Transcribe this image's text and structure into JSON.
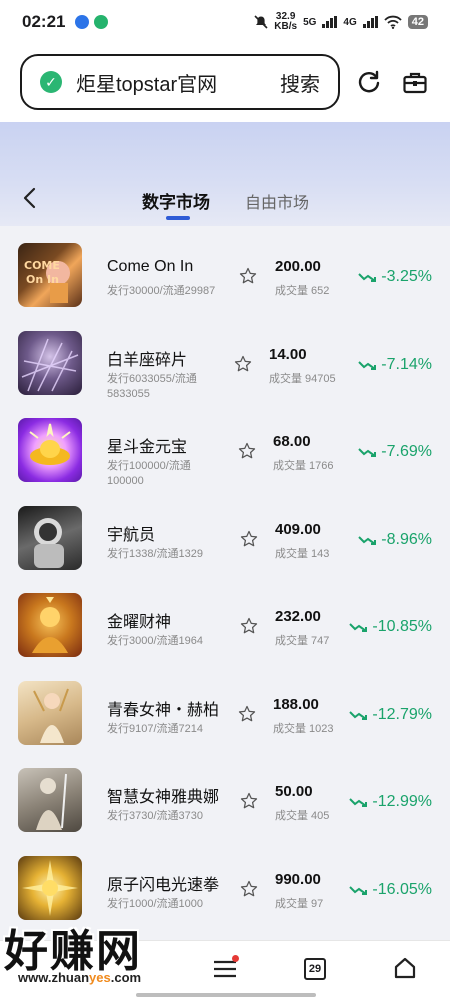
{
  "status_bar": {
    "time": "02:21",
    "net_speed": "32.9",
    "net_unit": "KB/s",
    "sig1": "5G",
    "sig2": "4G",
    "battery": "42"
  },
  "browser": {
    "url_text": "炬星topstar官网",
    "search_label": "搜索"
  },
  "header": {
    "tab_active": "数字市场",
    "tab_other": "自由市场"
  },
  "colors": {
    "accent": "#2e5bd6",
    "down": "#1aa36b"
  },
  "items": [
    {
      "name": "Come On In",
      "sub": "发行30000/流通29987",
      "price": "200.00",
      "volume": "成交量 652",
      "change": "-3.25%"
    },
    {
      "name": "白羊座碎片",
      "sub": "发行6033055/流通5833055",
      "price": "14.00",
      "volume": "成交量 94705",
      "change": "-7.14%"
    },
    {
      "name": "星斗金元宝",
      "sub": "发行100000/流通100000",
      "price": "68.00",
      "volume": "成交量 1766",
      "change": "-7.69%"
    },
    {
      "name": "宇航员",
      "sub": "发行1338/流通1329",
      "price": "409.00",
      "volume": "成交量 143",
      "change": "-8.96%"
    },
    {
      "name": "金曜财神",
      "sub": "发行3000/流通1964",
      "price": "232.00",
      "volume": "成交量 747",
      "change": "-10.85%"
    },
    {
      "name": "青春女神・赫柏",
      "sub": "发行9107/流通7214",
      "price": "188.00",
      "volume": "成交量 1023",
      "change": "-12.79%"
    },
    {
      "name": "智慧女神雅典娜",
      "sub": "发行3730/流通3730",
      "price": "50.00",
      "volume": "成交量 405",
      "change": "-12.99%"
    },
    {
      "name": "原子闪电光速拳",
      "sub": "发行1000/流通1000",
      "price": "990.00",
      "volume": "成交量 97",
      "change": "-16.05%"
    }
  ],
  "bottom_nav": {
    "tabs_count": "29"
  },
  "watermark": {
    "big": "好赚网",
    "small_prefix": "www.zhuan",
    "small_highlight": "yes",
    "small_suffix": ".com"
  }
}
